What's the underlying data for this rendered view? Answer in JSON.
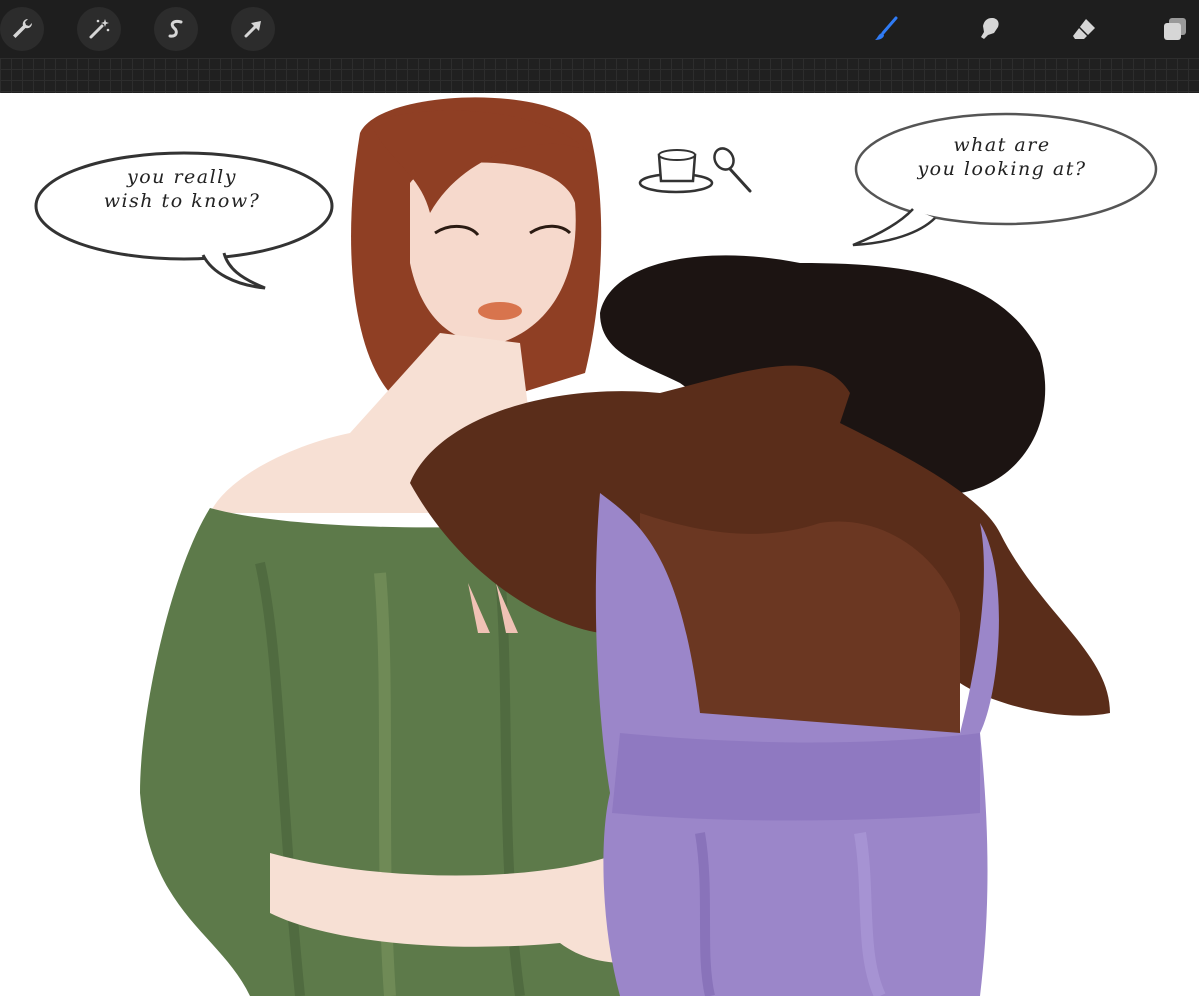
{
  "app": {
    "colors": {
      "toolbar_bg": "#1e1e1e",
      "icon": "#d6d6d6",
      "active_tool": "#2f7bf5",
      "canvas_bg": "#ffffff"
    }
  },
  "toolbar": {
    "left_tools": [
      {
        "name": "actions",
        "icon": "wrench-icon"
      },
      {
        "name": "adjustments",
        "icon": "magic-wand-icon"
      },
      {
        "name": "selection",
        "icon": "selection-s-icon"
      },
      {
        "name": "transform",
        "icon": "arrow-cursor-icon"
      }
    ],
    "right_tools": [
      {
        "name": "brush",
        "icon": "brush-icon",
        "active": true
      },
      {
        "name": "smudge",
        "icon": "smudge-finger-icon",
        "active": false
      },
      {
        "name": "eraser",
        "icon": "eraser-icon",
        "active": false
      },
      {
        "name": "layers",
        "icon": "layers-icon",
        "active": false
      }
    ]
  },
  "canvas": {
    "bubbles": [
      {
        "text": "you really\nwish to know?"
      },
      {
        "text": "what are\nyou looking at?"
      }
    ],
    "props": [
      "teacup-icon",
      "spoon-icon"
    ],
    "figures": [
      {
        "outfit": "green off-shoulder dress",
        "hair": "auburn"
      },
      {
        "outfit": "lavender ruffled dress",
        "hair": "dark curly"
      }
    ]
  }
}
